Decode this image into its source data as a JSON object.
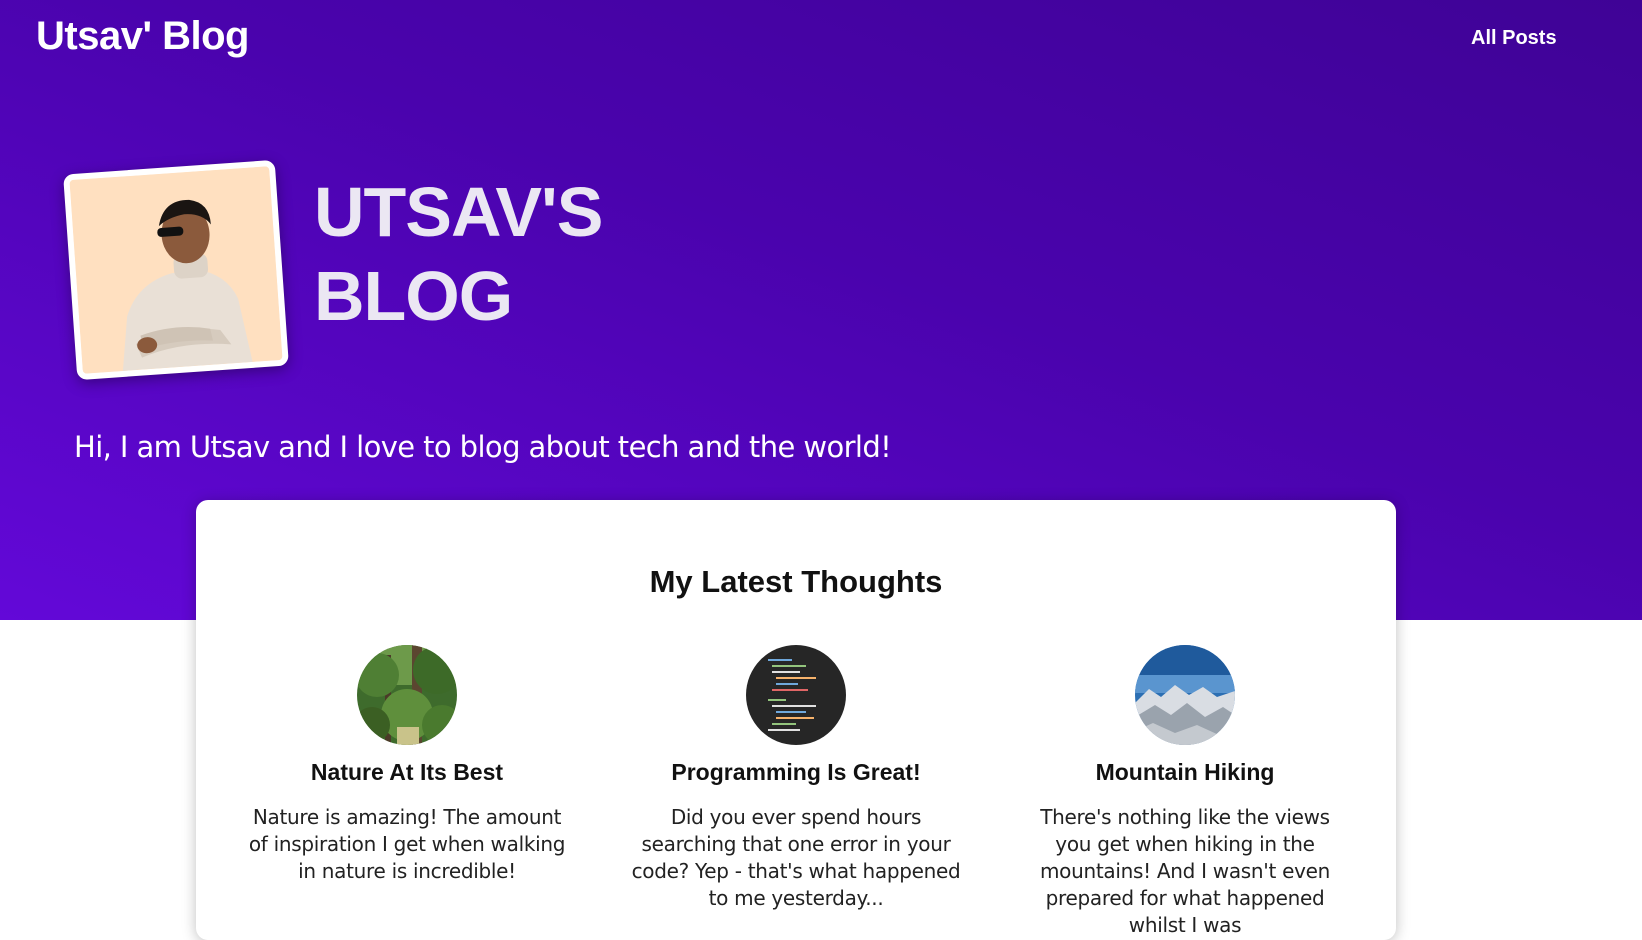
{
  "header": {
    "site_title": "Utsav' Blog",
    "nav": [
      {
        "label": "All Posts"
      }
    ]
  },
  "hero": {
    "title_line1": "UTSAV'S",
    "title_line2": "BLOG",
    "tagline": "Hi, I am Utsav and I love to blog about tech and the world!",
    "avatar_icon": "person-portrait-icon"
  },
  "latest": {
    "heading": "My Latest Thoughts",
    "posts": [
      {
        "title": "Nature At Its Best",
        "excerpt": "Nature is amazing! The amount of inspiration I get when walking in nature is incredible!",
        "thumb_icon": "forest-image"
      },
      {
        "title": "Programming Is Great!",
        "excerpt": "Did you ever spend hours searching that one error in your code? Yep - that's what happened to me yesterday...",
        "thumb_icon": "code-editor-image"
      },
      {
        "title": "Mountain Hiking",
        "excerpt": "There's nothing like the views you get when hiking in the mountains! And I wasn't even prepared for what happened whilst I was",
        "thumb_icon": "mountains-image"
      }
    ]
  },
  "colors": {
    "hero_gradient_start": "#3f0396",
    "hero_gradient_end": "#6308d8",
    "avatar_background": "#ffe0c0"
  }
}
